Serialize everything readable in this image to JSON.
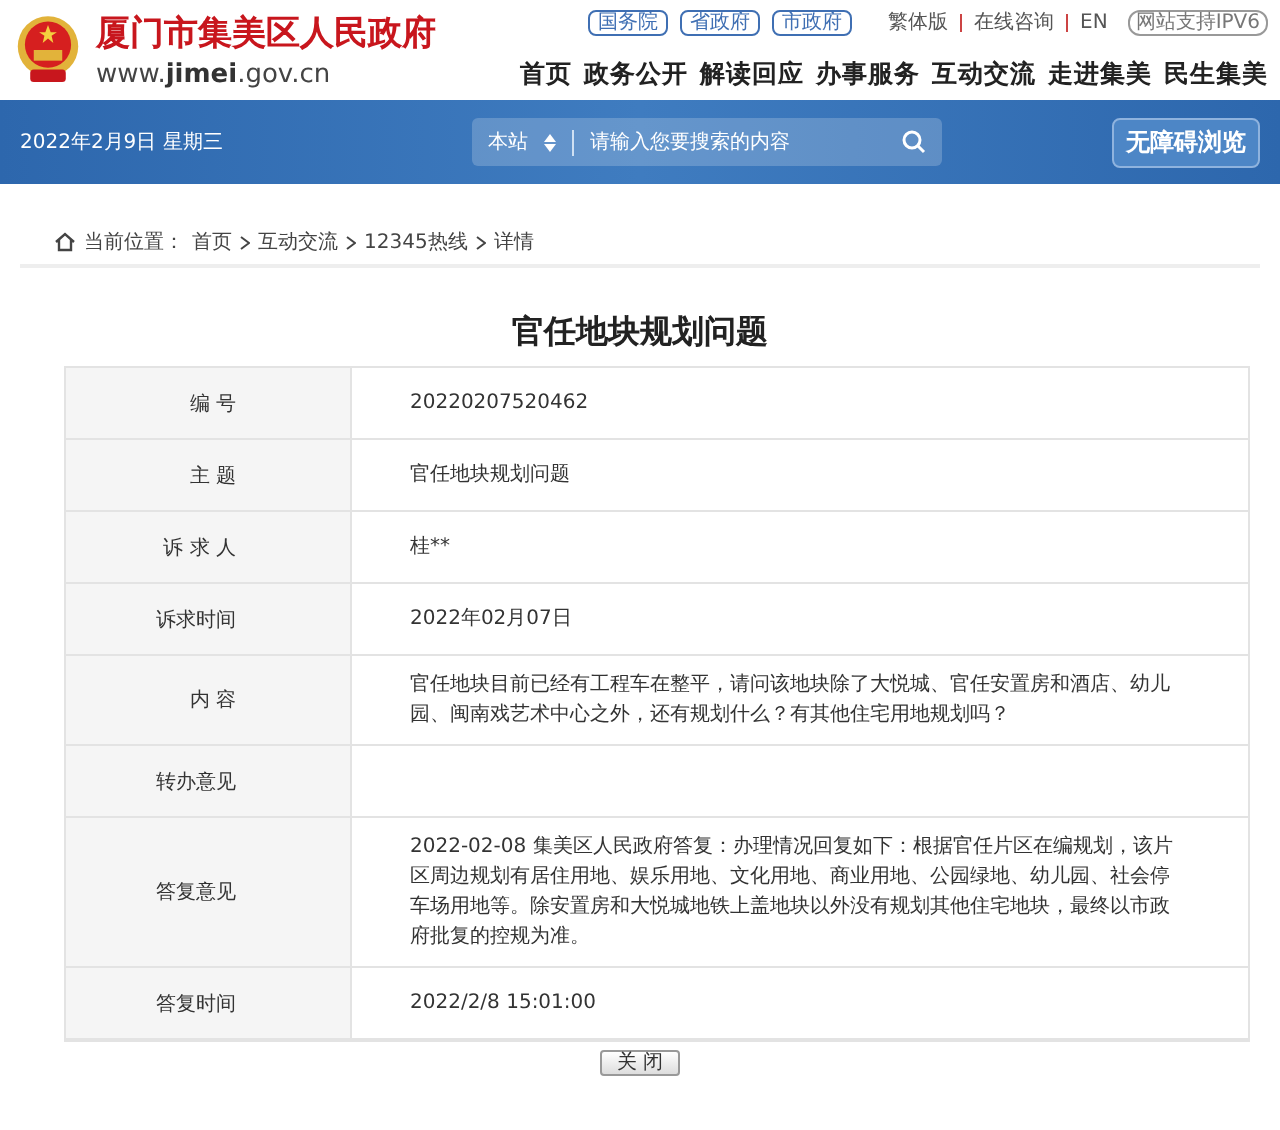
{
  "header": {
    "site_name": "厦门市集美区人民政府",
    "domain_prefix": "www.",
    "domain_main": "jimei",
    "domain_suffix": ".gov.cn",
    "top_links": [
      "国务院",
      "省政府",
      "市政府"
    ],
    "utility_links": [
      "繁体版",
      "在线咨询",
      "EN"
    ],
    "ipv6_badge": "网站支持IPV6",
    "nav": [
      "首页",
      "政务公开",
      "解读回应",
      "办事服务",
      "互动交流",
      "走进集美",
      "民生集美"
    ]
  },
  "banner": {
    "date": "2022年2月9日 星期三",
    "search_scope": "本站",
    "search_placeholder": "请输入您要搜索的内容",
    "accessibility_button": "无障碍浏览"
  },
  "breadcrumb": {
    "label": "当前位置：",
    "items": [
      "首页",
      "互动交流",
      "12345热线",
      "详情"
    ]
  },
  "title": "官任地块规划问题",
  "rows": [
    {
      "label": "编 号",
      "value": "20220207520462"
    },
    {
      "label": "主 题",
      "value": "官任地块规划问题"
    },
    {
      "label": "诉 求 人",
      "value": "桂**"
    },
    {
      "label": "诉求时间",
      "value": "2022年02月07日"
    },
    {
      "label": "内 容",
      "value": "官任地块目前已经有工程车在整平，请问该地块除了大悦城、官任安置房和酒店、幼儿园、闽南戏艺术中心之外，还有规划什么？有其他住宅用地规划吗？"
    },
    {
      "label": "转办意见"
    },
    {
      "label": "答复意见",
      "value": "2022-02-08 集美区人民政府答复：办理情况回复如下：根据官任片区在编规划，该片区周边规划有居住用地、娱乐用地、文化用地、商业用地、公园绿地、幼儿园、社会停车场用地等。除安置房和大悦城地铁上盖地块以外没有规划其他住宅地块，最终以市政府批复的控规为准。"
    },
    {
      "label": "答复时间",
      "value": "2022/2/8 15:01:00"
    }
  ],
  "close_button": "关 闭"
}
